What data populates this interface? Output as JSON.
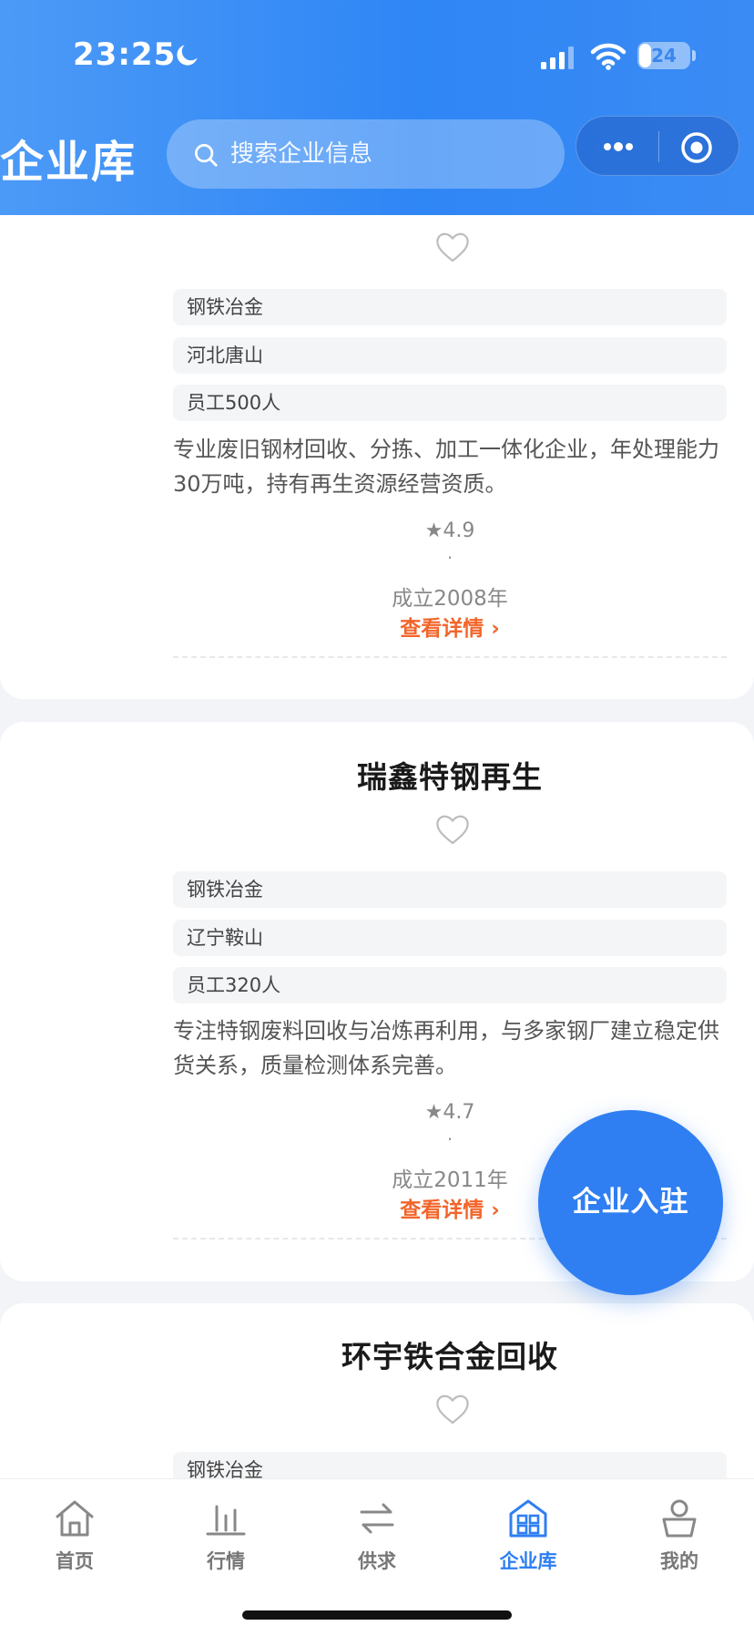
{
  "status_bar": {
    "time": "23:25",
    "battery_level": "24"
  },
  "header": {
    "title": "企业库",
    "search_placeholder": "搜索企业信息"
  },
  "companies": [
    {
      "name": "",
      "tags": [
        "钢铁冶金",
        "河北唐山",
        "员工500人"
      ],
      "description": "专业废旧钢材回收、分拣、加工一体化企业，年处理能力30万吨，持有再生资源经营资质。",
      "rating": "★4.9",
      "separator": "·",
      "founded": "成立2008年",
      "detail_label": "查看详情 ›"
    },
    {
      "name": "瑞鑫特钢再生",
      "tags": [
        "钢铁冶金",
        "辽宁鞍山",
        "员工320人"
      ],
      "description": "专注特钢废料回收与冶炼再利用，与多家钢厂建立稳定供货关系，质量检测体系完善。",
      "rating": "★4.7",
      "separator": "·",
      "founded": "成立2011年",
      "detail_label": "查看详情 ›"
    },
    {
      "name": "环宇铁合金回收",
      "tags": [
        "钢铁冶金"
      ]
    }
  ],
  "fab": {
    "label": "企业入驻"
  },
  "tabbar": {
    "items": [
      {
        "label": "首页",
        "icon": "home-icon"
      },
      {
        "label": "行情",
        "icon": "chart-icon"
      },
      {
        "label": "供求",
        "icon": "swap-icon"
      },
      {
        "label": "企业库",
        "icon": "building-icon",
        "active": true
      },
      {
        "label": "我的",
        "icon": "user-icon"
      }
    ],
    "active_color": "#2f7ff2",
    "inactive_color": "#777777"
  },
  "colors": {
    "header_gradient_start": "#4c9af7",
    "header_gradient_end": "#2f86f5",
    "accent_link": "#f2652a",
    "fab": "#2f7ff2"
  }
}
